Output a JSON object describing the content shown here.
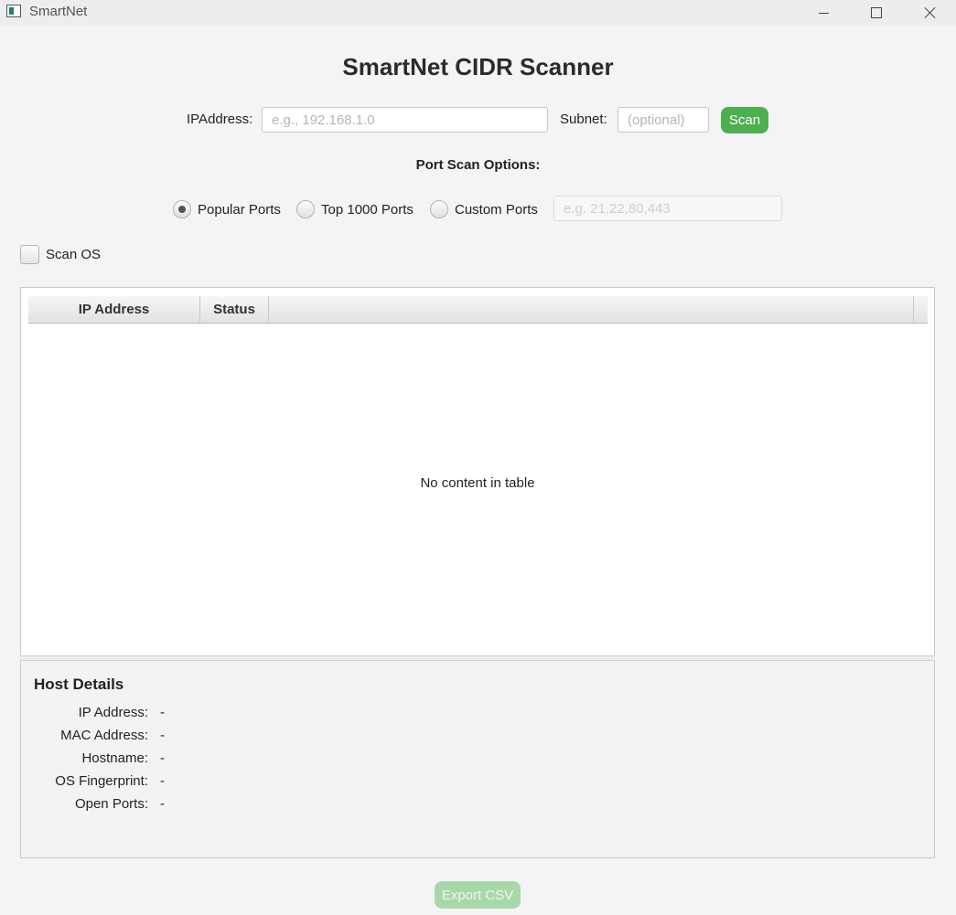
{
  "window": {
    "title": "SmartNet",
    "icon": "app-window-icon"
  },
  "header": {
    "title": "SmartNet CIDR Scanner"
  },
  "form": {
    "ip_label": "IPAddress:",
    "ip_placeholder": "e.g., 192.168.1.0",
    "ip_value": "",
    "subnet_label": "Subnet:",
    "subnet_placeholder": "(optional)",
    "subnet_value": "",
    "scan_label": "Scan"
  },
  "port_options": {
    "section_label": "Port Scan Options:",
    "radios": [
      {
        "label": "Popular Ports",
        "selected": true
      },
      {
        "label": "Top 1000 Ports",
        "selected": false
      },
      {
        "label": "Custom Ports",
        "selected": false
      }
    ],
    "custom_placeholder": "e.g. 21,22,80,443",
    "custom_enabled": false
  },
  "scan_os": {
    "label": "Scan OS",
    "checked": false
  },
  "table": {
    "columns": [
      "IP Address",
      "Status"
    ],
    "rows": [],
    "empty_message": "No content in table"
  },
  "host_details": {
    "title": "Host Details",
    "fields": [
      {
        "label": "IP Address:",
        "value": "-"
      },
      {
        "label": "MAC Address:",
        "value": "-"
      },
      {
        "label": "Hostname:",
        "value": "-"
      },
      {
        "label": "OS Fingerprint:",
        "value": "-"
      },
      {
        "label": "Open Ports:",
        "value": "-"
      }
    ]
  },
  "footer": {
    "export_label": "Export CSV",
    "export_enabled": false
  },
  "colors": {
    "accent": "#4caf50",
    "accent_disabled": "#a8d8aa"
  }
}
